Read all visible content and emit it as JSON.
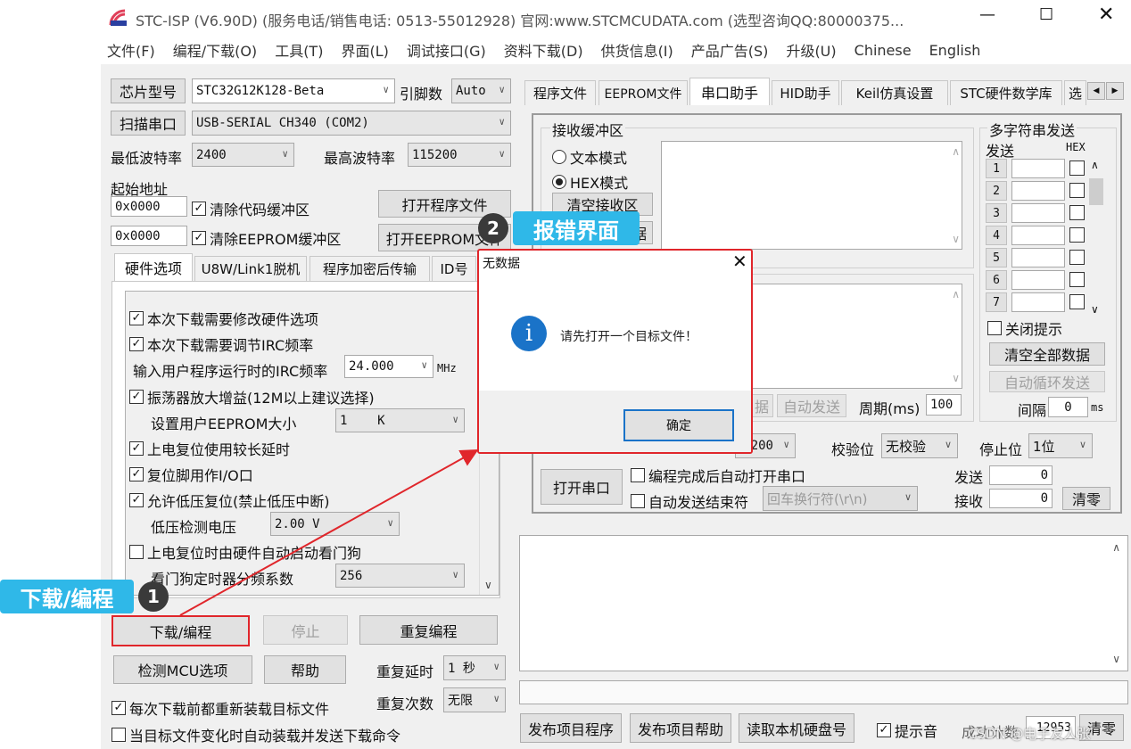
{
  "title": "STC-ISP (V6.90D) (服务电话/销售电话: 0513-55012928) 官网:www.STCMCUDATA.com  (选型咨询QQ:80000375...",
  "menu": [
    "文件(F)",
    "编程/下载(O)",
    "工具(T)",
    "界面(L)",
    "调试接口(G)",
    "资料下载(D)",
    "供货信息(I)",
    "产品广告(S)",
    "升级(U)",
    "Chinese",
    "English"
  ],
  "left": {
    "chip_btn": "芯片型号",
    "chip_value": "STC32G12K128-Beta",
    "pins_label": "引脚数",
    "pins_value": "Auto",
    "scan_btn": "扫描串口",
    "port_value": "USB-SERIAL CH340 (COM2)",
    "min_baud_label": "最低波特率",
    "min_baud": "2400",
    "max_baud_label": "最高波特率",
    "max_baud": "115200",
    "start_addr_label": "起始地址",
    "addr1": "0x0000",
    "addr2": "0x0000",
    "clear_code": "清除代码缓冲区",
    "clear_eeprom": "清除EEPROM缓冲区",
    "open_prog": "打开程序文件",
    "open_eeprom": "打开EEPROM文件",
    "tabs": [
      "硬件选项",
      "U8W/Link1脱机",
      "程序加密后传输",
      "ID号"
    ],
    "options": [
      {
        "label": "本次下载需要修改硬件选项",
        "checked": true
      },
      {
        "label": "本次下载需要调节IRC频率",
        "checked": true
      },
      {
        "label": "输入用户程序运行时的IRC频率",
        "value": "24.000",
        "unit": "MHz"
      },
      {
        "label": "振荡器放大增益(12M以上建议选择)",
        "checked": true
      },
      {
        "label": "设置用户EEPROM大小",
        "value": "1    K"
      },
      {
        "label": "上电复位使用较长延时",
        "checked": true
      },
      {
        "label": "复位脚用作I/O口",
        "checked": true
      },
      {
        "label": "允许低压复位(禁止低压中断)",
        "checked": true
      },
      {
        "label": "低压检测电压",
        "value": "2.00 V"
      },
      {
        "label": "上电复位时由硬件自动启动看门狗",
        "checked": false
      },
      {
        "label": "看门狗定时器分频系数",
        "value": "256"
      }
    ],
    "download_btn": "下载/编程",
    "stop_btn": "停止",
    "repeat_btn": "重复编程",
    "detect_btn": "检测MCU选项",
    "help_btn": "帮助",
    "repeat_delay_label": "重复延时",
    "repeat_delay": "1 秒",
    "repeat_count_label": "重复次数",
    "repeat_count": "无限",
    "reload_cb": "每次下载前都重新装载目标文件",
    "auto_load_cb": "当目标文件变化时自动装载并发送下载命令"
  },
  "right": {
    "tabs": [
      "程序文件",
      "EEPROM文件",
      "串口助手",
      "HID助手",
      "Keil仿真设置",
      "STC硬件数学库",
      "选"
    ],
    "recv_group": "接收缓冲区",
    "text_mode": "文本模式",
    "hex_mode": "HEX模式",
    "clear_recv": "清空接收区",
    "save_recv": "据",
    "send_partial": "据",
    "auto_send": "自动发送",
    "period_label": "周期(ms)",
    "period": "100",
    "multi_group": "多字符串发送",
    "send_col": "发送",
    "hex_col": "HEX",
    "rows": [
      "1",
      "2",
      "3",
      "4",
      "5",
      "6",
      "7"
    ],
    "close_hint": "关闭提示",
    "clear_all": "清空全部数据",
    "auto_loop": "自动循环发送",
    "interval_label": "间隔",
    "interval": "0",
    "ms": "ms",
    "baud_partial": "200",
    "parity_label": "校验位",
    "parity": "无校验",
    "stop_label": "停止位",
    "stop": "1位",
    "open_port": "打开串口",
    "auto_open_cb": "编程完成后自动打开串口",
    "auto_end_cb": "自动发送结束符",
    "end_char": "回车换行符(\\r\\n)",
    "sent_label": "发送",
    "sent": "0",
    "recv_label": "接收",
    "recv": "0",
    "clear_btn": "清零"
  },
  "bottom": {
    "publish_prog": "发布项目程序",
    "publish_help": "发布项目帮助",
    "read_disk": "读取本机硬盘号",
    "sound_cb": "提示音",
    "success_label": "成功计数",
    "success": "12953",
    "clear_btn": "清零"
  },
  "watermark": "CSDN @电子友人张",
  "dialog": {
    "title": "无数据",
    "message": "请先打开一个目标文件！",
    "ok": "确定"
  },
  "annotations": {
    "step1_num": "1",
    "step1_label": "下载/编程",
    "step2_num": "2",
    "step2_label": "报错界面"
  },
  "colors": {
    "annotation": "#2fb8e8",
    "highlight": "#e0262b",
    "info_icon": "#1a73c8"
  }
}
